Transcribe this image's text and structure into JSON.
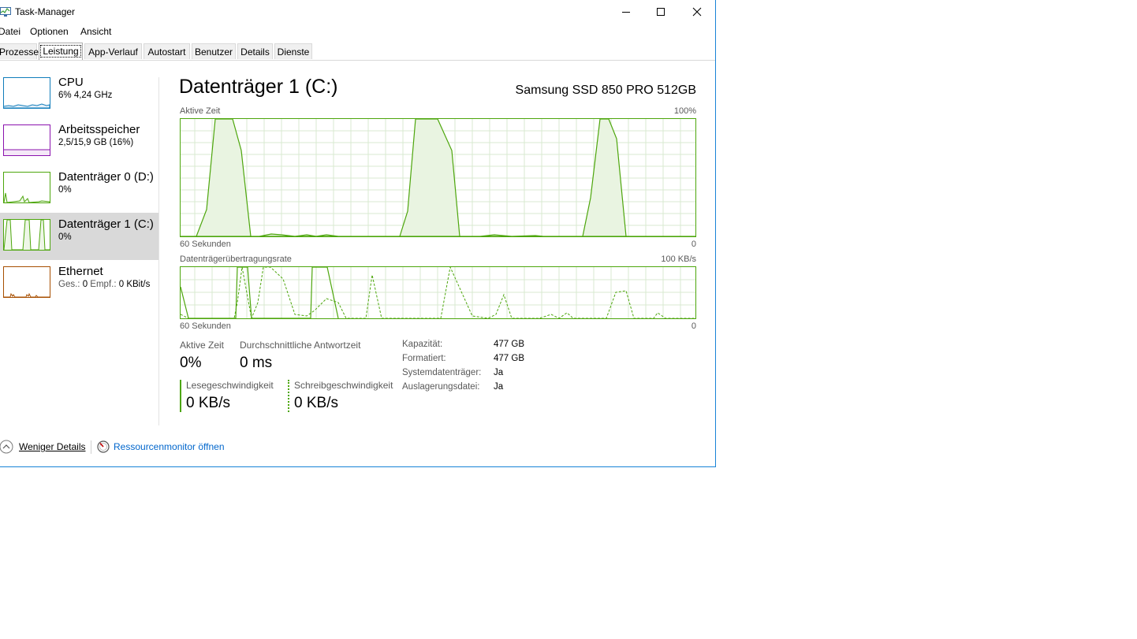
{
  "window": {
    "title": "Task-Manager",
    "controls": [
      "minimize",
      "maximize",
      "close"
    ]
  },
  "menu": {
    "items": [
      {
        "label": "Datei",
        "accel": "D"
      },
      {
        "label": "Optionen",
        "accel": "O"
      },
      {
        "label": "Ansicht",
        "accel": "A"
      }
    ]
  },
  "tabs": [
    {
      "label": "Prozesse"
    },
    {
      "label": "Leistung",
      "active": true
    },
    {
      "label": "App-Verlauf"
    },
    {
      "label": "Autostart"
    },
    {
      "label": "Benutzer"
    },
    {
      "label": "Details"
    },
    {
      "label": "Dienste"
    }
  ],
  "sidebar": {
    "items": [
      {
        "title": "CPU",
        "sub": "6%  4,24 GHz",
        "color": "#117dbb"
      },
      {
        "title": "Arbeitsspeicher",
        "sub": "2,5/15,9 GB (16%)",
        "color": "#8b12ae"
      },
      {
        "title": "Datenträger 0 (D:)",
        "sub": "0%",
        "color": "#4da60c"
      },
      {
        "title": "Datenträger 1 (C:)",
        "sub": "0%",
        "color": "#4da60c",
        "selected": true
      },
      {
        "title": "Ethernet",
        "sub_prefix": "Ges.:",
        "sub_send": "0",
        "sub_recv_prefix": "Empf.:",
        "sub_recv": "0 KBit/s",
        "color": "#a74f01"
      }
    ]
  },
  "main": {
    "title": "Datenträger 1 (C:)",
    "device": "Samsung SSD 850 PRO 512GB",
    "graph1": {
      "label": "Aktive Zeit",
      "max": "100%",
      "time": "60 Sekunden",
      "min": "0"
    },
    "graph2": {
      "label": "Datenträgerübertragungsrate",
      "max": "100 KB/s",
      "time": "60 Sekunden",
      "min": "0"
    },
    "stats": {
      "active_label": "Aktive Zeit",
      "active_value": "0%",
      "resp_label": "Durchschnittliche Antwortzeit",
      "resp_value": "0 ms",
      "read_label": "Lesegeschwindigkeit",
      "read_value": "0 KB/s",
      "write_label": "Schreibgeschwindigkeit",
      "write_value": "0 KB/s"
    },
    "properties": [
      {
        "label": "Kapazität:",
        "value": "477 GB"
      },
      {
        "label": "Formatiert:",
        "value": "477 GB"
      },
      {
        "label": "Systemdatenträger:",
        "value": "Ja"
      },
      {
        "label": "Auslagerungsdatei:",
        "value": "Ja"
      }
    ]
  },
  "footer": {
    "fewer_details": "Weniger Details",
    "fewer_accel": "W",
    "resource_monitor": "Ressourcenmonitor öffnen"
  },
  "colors": {
    "disk": "#4da60c",
    "cpu": "#117dbb",
    "memory": "#8b12ae",
    "ethernet": "#a74f01",
    "selection": "#d9d9d9"
  }
}
